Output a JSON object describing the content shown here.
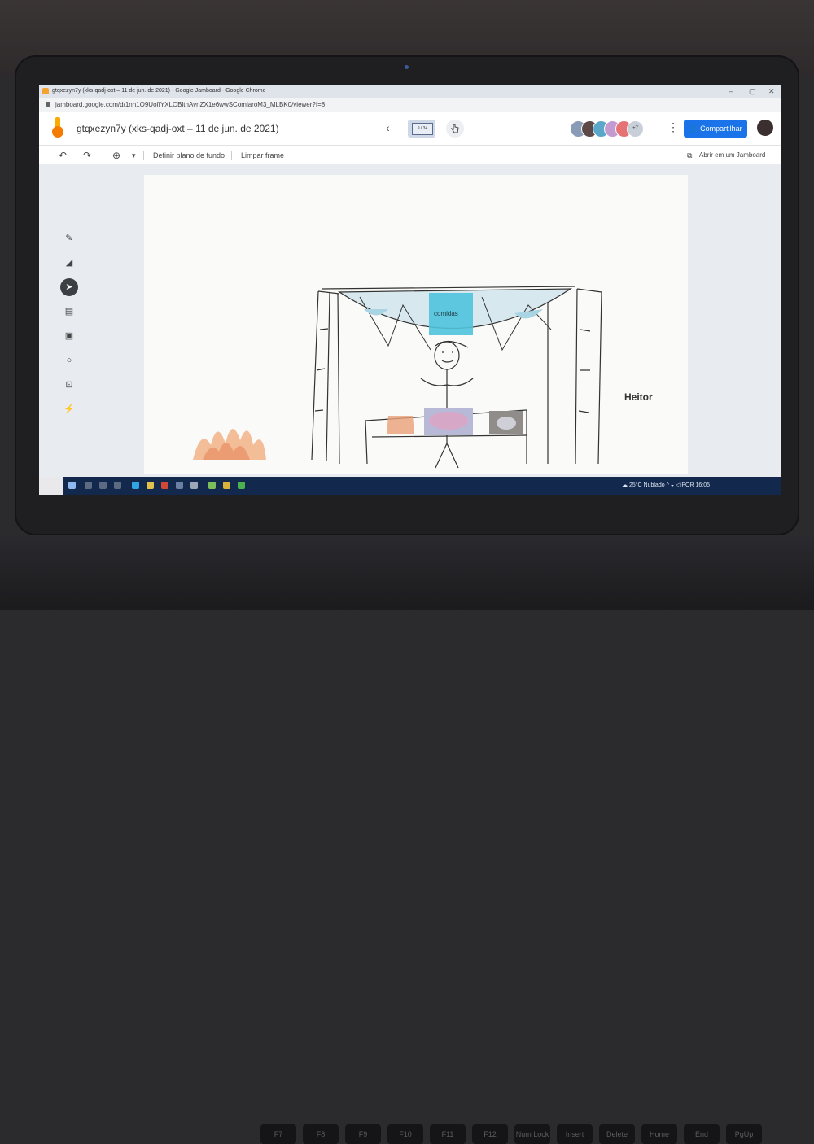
{
  "browser": {
    "window_title": "gtqxezyn7y (xks-qadj-oxt – 11 de jun. de 2021) - Google Jamboard - Google Chrome",
    "url": "jamboard.google.com/d/1nh1O9UoffYXLOBlthAvnZX1e6wwSComlaroM3_MLBK0/viewer?f=8",
    "controls": {
      "minimize": "–",
      "maximize": "▢",
      "close": "✕"
    }
  },
  "jamboard": {
    "title": "gtqxezyn7y (xks-qadj-oxt – 11 de jun. de 2021)",
    "frame_indicator": "9 / 34",
    "avatars_more": "+7",
    "share_label": "Compartilhar",
    "open_in_jamboard_label": "Abrir em um Jamboard",
    "toolbar": {
      "undo": "↶",
      "redo": "↷",
      "zoom": "⊕",
      "zoom_dropdown": "▾",
      "set_background": "Definir plano de fundo",
      "clear_frame": "Limpar frame"
    },
    "canvas": {
      "sticky_note": "comidas",
      "name_label": "Heitor"
    },
    "colors": {
      "share_blue": "#1a73e8",
      "sticky_cyan": "#4fc3dc",
      "taskbar": "#12294d"
    }
  },
  "taskbar": {
    "weather": "25°C Nublado",
    "time": "16:05",
    "language": "POR"
  },
  "keyboard_keys": [
    "F7",
    "F8",
    "F9",
    "F10",
    "F11",
    "F12",
    "Num Lock",
    "Insert",
    "Delete",
    "Home",
    "End",
    "PgUp"
  ]
}
